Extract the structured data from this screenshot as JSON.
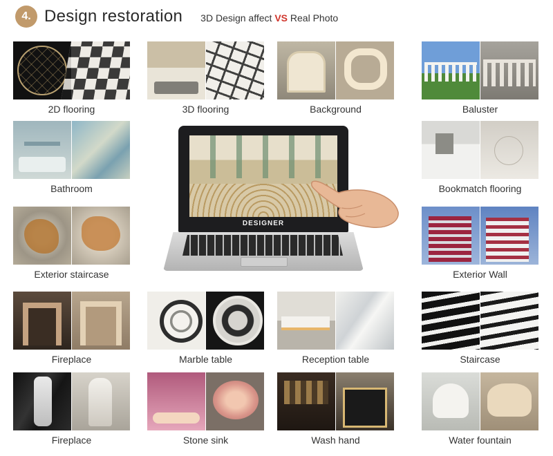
{
  "header": {
    "number": "4.",
    "title": "Design restoration",
    "subtitle_before": "3D Design affect ",
    "subtitle_vs": "VS",
    "subtitle_after": " Real Photo",
    "accent_color": "#c19a6b",
    "vs_color": "#d0352c"
  },
  "laptop": {
    "brand": "DESIGNER"
  },
  "items": [
    {
      "label": "2D flooring"
    },
    {
      "label": "3D flooring"
    },
    {
      "label": "Background"
    },
    {
      "label": "Baluster"
    },
    {
      "label": "Bathroom"
    },
    {
      "label": "Bookmatch flooring"
    },
    {
      "label": "Exterior staircase"
    },
    {
      "label": "Exterior Wall"
    },
    {
      "label": "Fireplace"
    },
    {
      "label": "Marble table"
    },
    {
      "label": "Reception table"
    },
    {
      "label": "Staircase"
    },
    {
      "label": "Fireplace"
    },
    {
      "label": "Stone sink"
    },
    {
      "label": "Wash hand"
    },
    {
      "label": "Water fountain"
    }
  ]
}
